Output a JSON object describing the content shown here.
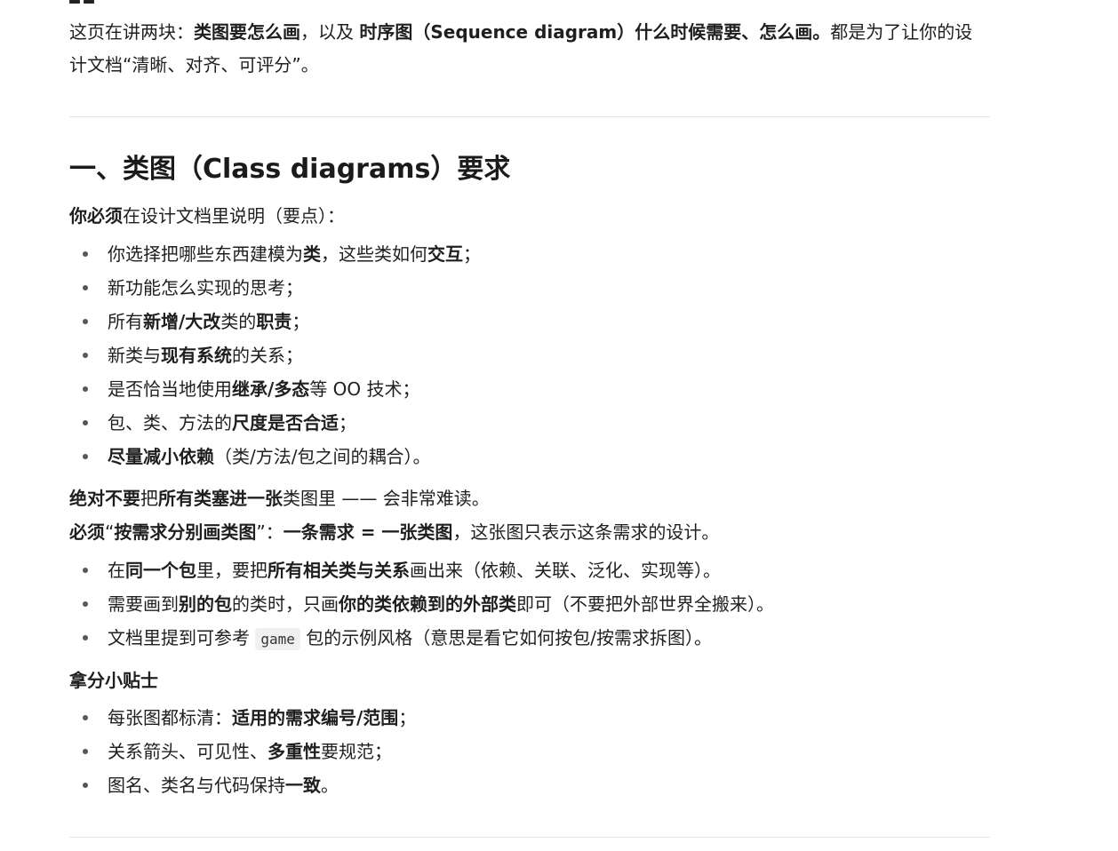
{
  "intro": {
    "t1": "这页在讲两块：",
    "b1": "类图要怎么画",
    "t2": "，以及 ",
    "b2": "时序图（Sequence diagram）什么时候需要、怎么画。",
    "t3": "都是为了让你的设计文档“清晰、对齐、可评分”。"
  },
  "section1": {
    "heading": "一、类图（Class diagrams）要求",
    "must_intro": {
      "b": "你必须",
      "t": "在设计文档里说明（要点）："
    },
    "must_items": [
      {
        "t1": "你选择把哪些东西建模为",
        "b1": "类",
        "t2": "，这些类如何",
        "b2": "交互",
        "t3": "；"
      },
      {
        "t1": "新功能怎么实现的思考；"
      },
      {
        "t1": "所有",
        "b1": "新增/大改",
        "t2": "类的",
        "b2": "职责",
        "t3": "；"
      },
      {
        "t1": "新类与",
        "b1": "现有系统",
        "t2": "的关系；"
      },
      {
        "t1": "是否恰当地使用",
        "b1": "继承/多态",
        "t2": "等 OO 技术；"
      },
      {
        "t1": "包、类、方法的",
        "b1": "尺度是否合适",
        "t2": "；"
      },
      {
        "b1": "尽量减小依赖",
        "t2": "（类/方法/包之间的耦合）。"
      }
    ],
    "never": {
      "b1": "绝对不要",
      "t1": "把",
      "b2": "所有类塞进一张",
      "t2": "类图里 —— 会非常难读。"
    },
    "mustdraw": {
      "b1": "必须",
      "t1": "“",
      "b2": "按需求分别画类图",
      "t2": "”：",
      "b3": "一条需求 = 一张类图",
      "t3": "，这张图只表示这条需求的设计。"
    },
    "draw_items": [
      {
        "t1": "在",
        "b1": "同一个包",
        "t2": "里，要把",
        "b2": "所有相关类与关系",
        "t3": "画出来（依赖、关联、泛化、实现等）。"
      },
      {
        "t1": "需要画到",
        "b1": "别的包",
        "t2": "的类时，只画",
        "b2": "你的类依赖到的外部类",
        "t3": "即可（不要把外部世界全搬来）。"
      },
      {
        "t1": "文档里提到可参考 ",
        "code": "game",
        "t2": " 包的示例风格（意思是看它如何按包/按需求拆图）。"
      }
    ],
    "tips_title": "拿分小贴士",
    "tips": [
      {
        "t1": "每张图都标清：",
        "b1": "适用的需求编号/范围",
        "t2": "；"
      },
      {
        "t1": "关系箭头、可见性、",
        "b1": "多重性",
        "t2": "要规范；"
      },
      {
        "t1": "图名、类名与代码保持",
        "b1": "一致",
        "t2": "。"
      }
    ]
  }
}
